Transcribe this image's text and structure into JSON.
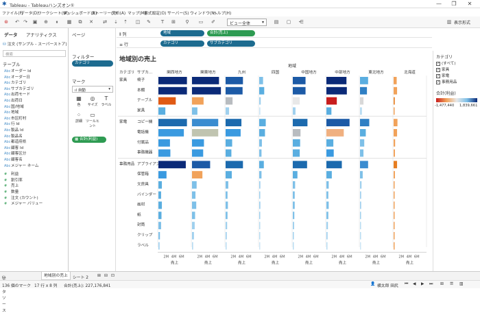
{
  "app": {
    "title": "Tableau - Tableauハンズオン①",
    "window_buttons": [
      "—",
      "❐",
      "✕"
    ]
  },
  "menu": [
    "ファイル(F)",
    "データ(D)",
    "ワークシート(W)",
    "ダッシュボード(B)",
    "ストーリー(T)",
    "分析(A)",
    "マップ(M)",
    "書式設定(O)",
    "サーバー(S)",
    "ウィンドウ(N)",
    "ヘルプ(H)"
  ],
  "toolbar": {
    "view_select": "ビュー全体",
    "present_label": "表示形式"
  },
  "data_pane": {
    "tab_data": "データ",
    "tab_analytics": "アナリティクス",
    "datasource": "注文 (サンプル - スーパーストア)",
    "search_placeholder": "検索",
    "table_header": "テーブル",
    "dimensions": [
      "オーダー Id",
      "オーダー日",
      "カテゴリ",
      "サブカテゴリ",
      "出荷モード",
      "出荷日",
      "国/地域",
      "地域",
      "市区町村",
      "行 Id",
      "製品 Id",
      "製品名",
      "都道府県",
      "顧客 Id",
      "顧客区分",
      "顧客名",
      "メジャー ネーム"
    ],
    "measures": [
      "利益",
      "割引率",
      "売上",
      "数量",
      "注文 (カウント)",
      "メジャー バリュー"
    ]
  },
  "shelves": {
    "pages_label": "ページ",
    "filters_label": "フィルター",
    "filter_pill": "カテゴリ",
    "marks_label": "マーク",
    "mark_type": "自動",
    "mark_buttons": [
      {
        "icon": "color-icon",
        "glyph": "▦",
        "label": "色"
      },
      {
        "icon": "size-icon",
        "glyph": "◎",
        "label": "サイズ"
      },
      {
        "icon": "label-icon",
        "glyph": "T",
        "label": "ラベル"
      },
      {
        "icon": "detail-icon",
        "glyph": "⁘",
        "label": "詳細"
      },
      {
        "icon": "tooltip-icon",
        "glyph": "▭",
        "label": "ツールヒント"
      }
    ],
    "marks_pill": "合計(利益)",
    "columns_label": "列",
    "columns_pills": [
      "地域",
      "合計(売上)"
    ],
    "rows_label": "行",
    "rows_pills": [
      "カテゴリ",
      "サブカテゴリ"
    ]
  },
  "viz": {
    "title": "地域別の売上",
    "top_header": "地域",
    "row_header_1": "カテゴリ",
    "row_header_2": "サブカ..."
  },
  "legend": {
    "filter_title": "カテゴリ",
    "filter_items": [
      "(すべて)",
      "家具",
      "家電",
      "事務用品"
    ],
    "color_title": "合計(利益)",
    "color_min": "-1,477,440",
    "color_max": "1,839,661",
    "colors": [
      "#c81d1d",
      "#f1a25a",
      "#e8e8e8",
      "#7ec0e8",
      "#0b2a78"
    ]
  },
  "bottom": {
    "datasource_tab": "データ ソース",
    "sheet_tabs": [
      "地域別の売上",
      "シート 2"
    ],
    "status_marks": "136 個のマーク",
    "status_dims": "17 行 x 8 列",
    "status_sum": "合計(売上): 227,176,841",
    "status_user": "横太郎 田尻"
  },
  "chart_data": {
    "type": "bar",
    "x_label": "売上",
    "x_ticks": [
      "2M",
      "4M",
      "6M"
    ],
    "xlim": [
      0,
      8000000
    ],
    "regions": [
      "関西地方",
      "関東地方",
      "九州",
      "四国",
      "中国地方",
      "中部地方",
      "東北地方",
      "北海道"
    ],
    "groups": [
      {
        "category": "家具",
        "subcategories": [
          "椅子",
          "本棚",
          "テーブル",
          "家具"
        ]
      },
      {
        "category": "家電",
        "subcategories": [
          "コピー機",
          "電話機",
          "付属品",
          "事務機器"
        ]
      },
      {
        "category": "事務用品",
        "subcategories": [
          "アプライアンス",
          "保管箱",
          "文房具",
          "バインダー",
          "画材",
          "紙",
          "封筒",
          "クリップ",
          "ラベル"
        ]
      }
    ],
    "sales": [
      [
        7400000,
        7000000,
        4500000,
        1000000,
        3300000,
        5200000,
        2100000,
        800000
      ],
      [
        7400000,
        7500000,
        4400000,
        1300000,
        3300000,
        5300000,
        1800000,
        900000
      ],
      [
        4500000,
        3000000,
        1800000,
        400000,
        1800000,
        2700000,
        900000,
        300000
      ],
      [
        1800000,
        1400000,
        900000,
        300000,
        700000,
        1300000,
        500000,
        200000
      ],
      [
        7400000,
        6800000,
        4100000,
        1700000,
        3800000,
        6000000,
        2400000,
        1000000
      ],
      [
        6600000,
        6800000,
        3900000,
        1500000,
        2000000,
        4500000,
        1500000,
        900000
      ],
      [
        3000000,
        3100000,
        1700000,
        700000,
        1900000,
        1800000,
        1100000,
        400000
      ],
      [
        3100000,
        2900000,
        1500000,
        600000,
        1800000,
        1900000,
        900000,
        350000
      ],
      [
        7100000,
        4700000,
        4500000,
        1200000,
        3700000,
        4000000,
        2100000,
        900000
      ],
      [
        2100000,
        2700000,
        1600000,
        600000,
        1200000,
        1400000,
        700000,
        350000
      ],
      [
        900000,
        1200000,
        700000,
        300000,
        600000,
        600000,
        400000,
        150000
      ],
      [
        700000,
        900000,
        500000,
        250000,
        500000,
        500000,
        300000,
        150000
      ],
      [
        900000,
        1100000,
        600000,
        300000,
        500000,
        600000,
        300000,
        150000
      ],
      [
        800000,
        800000,
        500000,
        250000,
        400000,
        500000,
        250000,
        100000
      ],
      [
        700000,
        700000,
        400000,
        200000,
        350000,
        400000,
        200000,
        100000
      ],
      [
        400000,
        500000,
        300000,
        150000,
        250000,
        300000,
        150000,
        80000
      ],
      [
        300000,
        300000,
        200000,
        100000,
        200000,
        200000,
        100000,
        50000
      ]
    ],
    "profit_color": [
      [
        "#0b2a78",
        "#0b2a78",
        "#1c5aa6",
        "#7ec0e8",
        "#1c5aa6",
        "#0b2a78",
        "#5aaee0",
        "#f1a25a"
      ],
      [
        "#0b2a78",
        "#0b2a78",
        "#1c5aa6",
        "#5aaee0",
        "#1c5aa6",
        "#0b2a78",
        "#2f7fc4",
        "#f1a25a"
      ],
      [
        "#e05a14",
        "#f1a25a",
        "#b8bcc0",
        "#9fd0ee",
        "#e8e8e8",
        "#c81d1d",
        "#d8d8d8",
        "#e67e22"
      ],
      [
        "#5aaee0",
        "#7ec0e8",
        "#9fd0ee",
        "#cde6f6",
        "#9fd0ee",
        "#5aaee0",
        "#b8dcf2",
        "#f1a25a"
      ],
      [
        "#1c6aae",
        "#3a8cd0",
        "#1c6aae",
        "#5aaee0",
        "#1c6aae",
        "#1c5aa6",
        "#2f7fc4",
        "#f1a25a"
      ],
      [
        "#3a9ae0",
        "#c0c4b0",
        "#3a9ae0",
        "#5aaee0",
        "#b8bcc0",
        "#f0b080",
        "#5aaee0",
        "#f1a25a"
      ],
      [
        "#3a9ae0",
        "#3a9ae0",
        "#5aaee0",
        "#7ec0e8",
        "#5aaee0",
        "#5aaee0",
        "#7ec0e8",
        "#f1a25a"
      ],
      [
        "#3a9ae0",
        "#3a9ae0",
        "#5aaee0",
        "#7ec0e8",
        "#5aaee0",
        "#3a9ae0",
        "#7ec0e8",
        "#f1a25a"
      ],
      [
        "#0b2a78",
        "#1c5aa6",
        "#1c6aae",
        "#5aaee0",
        "#1c6aae",
        "#1c6aae",
        "#3a8cd0",
        "#e67e22"
      ],
      [
        "#3a9ae0",
        "#f1a25a",
        "#5aaee0",
        "#7ec0e8",
        "#5aaee0",
        "#5aaee0",
        "#7ec0e8",
        "#f1a25a"
      ],
      [
        "#5aaee0",
        "#7ec0e8",
        "#7ec0e8",
        "#9fd0ee",
        "#7ec0e8",
        "#7ec0e8",
        "#9fd0ee",
        "#f1a25a"
      ],
      [
        "#5aaee0",
        "#7ec0e8",
        "#7ec0e8",
        "#9fd0ee",
        "#7ec0e8",
        "#7ec0e8",
        "#9fd0ee",
        "#f1a25a"
      ],
      [
        "#5aaee0",
        "#7ec0e8",
        "#7ec0e8",
        "#9fd0ee",
        "#7ec0e8",
        "#7ec0e8",
        "#9fd0ee",
        "#f1a25a"
      ],
      [
        "#5aaee0",
        "#7ec0e8",
        "#7ec0e8",
        "#9fd0ee",
        "#7ec0e8",
        "#7ec0e8",
        "#9fd0ee",
        "#f1a25a"
      ],
      [
        "#7ec0e8",
        "#9fd0ee",
        "#9fd0ee",
        "#b8dcf2",
        "#9fd0ee",
        "#9fd0ee",
        "#b8dcf2",
        "#f1a25a"
      ],
      [
        "#7ec0e8",
        "#9fd0ee",
        "#9fd0ee",
        "#b8dcf2",
        "#9fd0ee",
        "#9fd0ee",
        "#b8dcf2",
        "#f1a25a"
      ],
      [
        "#9fd0ee",
        "#b8dcf2",
        "#b8dcf2",
        "#cde6f6",
        "#b8dcf2",
        "#b8dcf2",
        "#cde6f6",
        "#f1a25a"
      ]
    ]
  }
}
